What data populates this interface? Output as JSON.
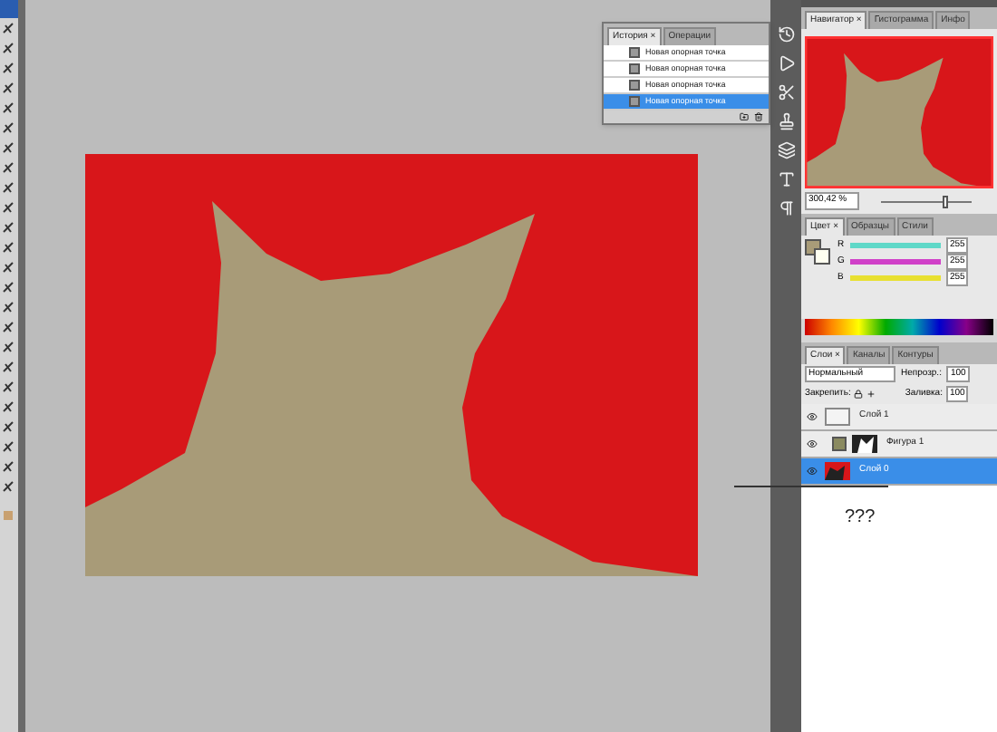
{
  "history_panel": {
    "tabs": [
      {
        "label": "История ×",
        "selected": true
      },
      {
        "label": "Операции",
        "selected": false
      }
    ],
    "items": [
      {
        "label": "Новая опорная точка",
        "selected": false
      },
      {
        "label": "Новая опорная точка",
        "selected": false
      },
      {
        "label": "Новая опорная точка",
        "selected": false
      },
      {
        "label": "Новая опорная точка",
        "selected": true
      }
    ]
  },
  "navigator_panel": {
    "tabs": [
      {
        "label": "Навигатор ×",
        "selected": true
      },
      {
        "label": "Гистограмма",
        "selected": false
      },
      {
        "label": "Инфо",
        "selected": false
      }
    ],
    "zoom": "300,42 %",
    "zoom_slider": {
      "level": 0.72
    }
  },
  "color_panel": {
    "tabs": [
      {
        "label": "Цвет ×",
        "selected": true
      },
      {
        "label": "Образцы",
        "selected": false
      },
      {
        "label": "Стили",
        "selected": false
      }
    ],
    "channels": [
      {
        "name": "R",
        "value": "255",
        "level": 1,
        "color": "#5fd8c8"
      },
      {
        "name": "G",
        "value": "255",
        "level": 1,
        "color": "#d040c8"
      },
      {
        "name": "B",
        "value": "255",
        "level": 1,
        "color": "#e8e030"
      }
    ]
  },
  "layers_panel": {
    "tabs": [
      {
        "label": "Слои ×",
        "selected": true
      },
      {
        "label": "Каналы",
        "selected": false
      },
      {
        "label": "Контуры",
        "selected": false
      }
    ],
    "blend_mode": "Нормальный",
    "opacity_label": "Непрозр.:",
    "opacity": "100",
    "lock_label": "Закрепить:",
    "fill_label": "Заливка:",
    "fill": "100",
    "layers": [
      {
        "name": "Слой 1",
        "kind": "raster",
        "selected": false,
        "visible": true
      },
      {
        "name": "Фигура 1",
        "kind": "shape",
        "selected": false,
        "visible": true
      },
      {
        "name": "Слой 0",
        "kind": "image",
        "selected": true,
        "visible": true
      }
    ]
  },
  "annotation": "???"
}
